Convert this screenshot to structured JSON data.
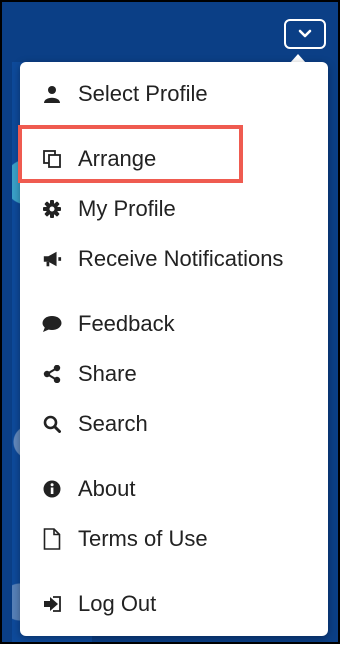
{
  "menu": {
    "items": [
      {
        "id": "select-profile",
        "label": "Select Profile",
        "icon": "user-icon"
      },
      {
        "id": "arrange",
        "label": "Arrange",
        "icon": "copy-icon"
      },
      {
        "id": "my-profile",
        "label": "My Profile",
        "icon": "gear-icon"
      },
      {
        "id": "receive-notifications",
        "label": "Receive Notifications",
        "icon": "megaphone-icon"
      },
      {
        "id": "feedback",
        "label": "Feedback",
        "icon": "comment-icon"
      },
      {
        "id": "share",
        "label": "Share",
        "icon": "share-icon"
      },
      {
        "id": "search",
        "label": "Search",
        "icon": "search-icon"
      },
      {
        "id": "about",
        "label": "About",
        "icon": "info-icon"
      },
      {
        "id": "terms-of-use",
        "label": "Terms of Use",
        "icon": "document-icon"
      },
      {
        "id": "log-out",
        "label": "Log Out",
        "icon": "sign-out-icon"
      }
    ]
  },
  "colors": {
    "header": "#0b3f86",
    "highlight": "#ef5b50",
    "menu_bg": "#ffffff",
    "text": "#222222"
  }
}
